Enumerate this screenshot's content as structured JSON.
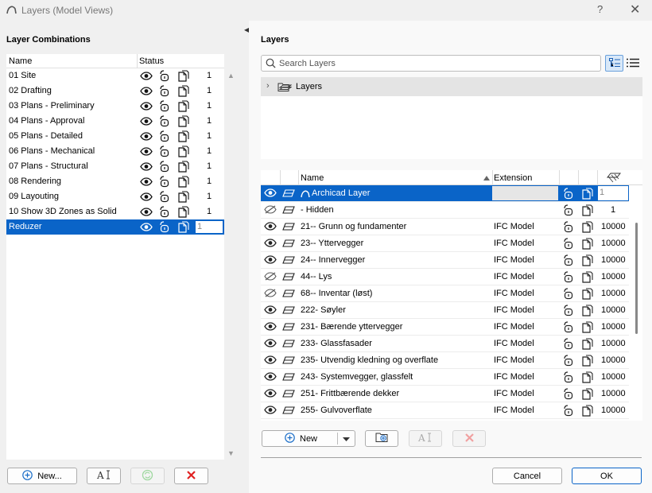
{
  "window": {
    "title": "Layers (Model Views)",
    "help": "?",
    "close": "✕"
  },
  "left": {
    "heading": "Layer Combinations",
    "col_name": "Name",
    "col_status": "Status",
    "items": [
      {
        "name": "01 Site",
        "count": "1"
      },
      {
        "name": "02 Drafting",
        "count": "1"
      },
      {
        "name": "03 Plans - Preliminary",
        "count": "1"
      },
      {
        "name": "04 Plans - Approval",
        "count": "1"
      },
      {
        "name": "05 Plans - Detailed",
        "count": "1"
      },
      {
        "name": "06 Plans - Mechanical",
        "count": "1"
      },
      {
        "name": "07 Plans - Structural",
        "count": "1"
      },
      {
        "name": "08 Rendering",
        "count": "1"
      },
      {
        "name": "09 Layouting",
        "count": "1"
      },
      {
        "name": "10 Show 3D Zones as Solid",
        "count": "1"
      },
      {
        "name": "Reduzer",
        "count": "1"
      }
    ],
    "new_button": "New...",
    "rename_icon": "AI"
  },
  "right": {
    "heading": "Layers",
    "search_placeholder": "Search Layers",
    "tree_root": "Layers",
    "col_name": "Name",
    "col_extension": "Extension",
    "layers": [
      {
        "name": "Archicad Layer",
        "extension": "",
        "num": "1",
        "visible": true
      },
      {
        "name": "- Hidden",
        "extension": "",
        "num": "1",
        "visible": false
      },
      {
        "name": "21-- Grunn og fundamenter",
        "extension": "IFC Model",
        "num": "10000",
        "visible": true
      },
      {
        "name": "23-- Yttervegger",
        "extension": "IFC Model",
        "num": "10000",
        "visible": true
      },
      {
        "name": "24-- Innervegger",
        "extension": "IFC Model",
        "num": "10000",
        "visible": true
      },
      {
        "name": "44-- Lys",
        "extension": "IFC Model",
        "num": "10000",
        "visible": false
      },
      {
        "name": "68-- Inventar (løst)",
        "extension": "IFC Model",
        "num": "10000",
        "visible": false
      },
      {
        "name": "222- Søyler",
        "extension": "IFC Model",
        "num": "10000",
        "visible": true
      },
      {
        "name": "231- Bærende yttervegger",
        "extension": "IFC Model",
        "num": "10000",
        "visible": true
      },
      {
        "name": "233- Glassfasader",
        "extension": "IFC Model",
        "num": "10000",
        "visible": true
      },
      {
        "name": "235- Utvendig kledning og overflate",
        "extension": "IFC Model",
        "num": "10000",
        "visible": true
      },
      {
        "name": "243- Systemvegger, glassfelt",
        "extension": "IFC Model",
        "num": "10000",
        "visible": true
      },
      {
        "name": "251- Frittbærende dekker",
        "extension": "IFC Model",
        "num": "10000",
        "visible": true
      },
      {
        "name": "255- Gulvoverflate",
        "extension": "IFC Model",
        "num": "10000",
        "visible": true
      }
    ],
    "new_button": "New",
    "cancel_button": "Cancel",
    "ok_button": "OK"
  },
  "colors": {
    "selection": "#0a64c8",
    "delete": "#e02020",
    "accent": "#0a64c8"
  }
}
